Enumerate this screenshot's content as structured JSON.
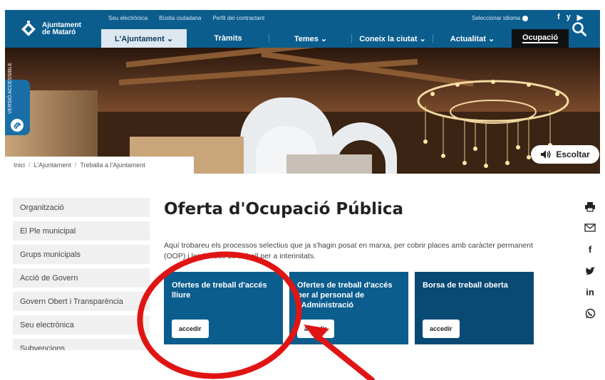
{
  "header": {
    "logo_line1": "Ajuntament",
    "logo_line2": "de Mataró",
    "top_links": [
      "Seu electrònica",
      "Bústia ciutadana",
      "Perfil del contractant"
    ],
    "language": "Seleccionar Idioma",
    "social": [
      "f",
      "y",
      "▶"
    ],
    "nav": [
      {
        "label": "L'Ajuntament ⌄"
      },
      {
        "label": "Tràmits"
      },
      {
        "label": "Temes ⌄"
      },
      {
        "label": "Coneix la ciutat ⌄"
      },
      {
        "label": "Actualitat ⌄"
      },
      {
        "label": "Ocupació"
      }
    ],
    "brand_color": "#0b5d8e"
  },
  "hero": {
    "accessible_label": "VERSIÓ ACCESSIBLE",
    "listen_label": "Escoltar"
  },
  "breadcrumb": [
    "Inici",
    "L'Ajuntament",
    "Treballa a l'Ajuntament"
  ],
  "sidebar": {
    "items": [
      {
        "label": "Organització"
      },
      {
        "label": "El Ple municipal"
      },
      {
        "label": "Grups municipals"
      },
      {
        "label": "Acció de Govern"
      },
      {
        "label": "Govern Obert i Transparència"
      },
      {
        "label": "Seu electrònica"
      },
      {
        "label": "Subvencions"
      }
    ]
  },
  "main": {
    "title": "Oferta d'Ocupació Pública",
    "intro": "Aquí trobareu els processos selectius que ja s'hagin posat en marxa, per cobrir places amb caràcter permanent (OOP) i les borses de treball per a interinitats.",
    "cards": [
      {
        "title": "Ofertes de treball d'accés lliure",
        "button": "accedir"
      },
      {
        "title": "Ofertes de treball d'accés per al personal de l'Administració",
        "button": "accedir"
      },
      {
        "title": "Borsa de treball oberta",
        "button": "accedir"
      }
    ]
  },
  "share": [
    "print-icon",
    "mail-icon",
    "facebook-icon",
    "twitter-icon",
    "linkedin-icon",
    "whatsapp-icon"
  ],
  "share_glyphs": {
    "facebook": "f",
    "linkedin": "in"
  },
  "annotation_color": "#e11414"
}
